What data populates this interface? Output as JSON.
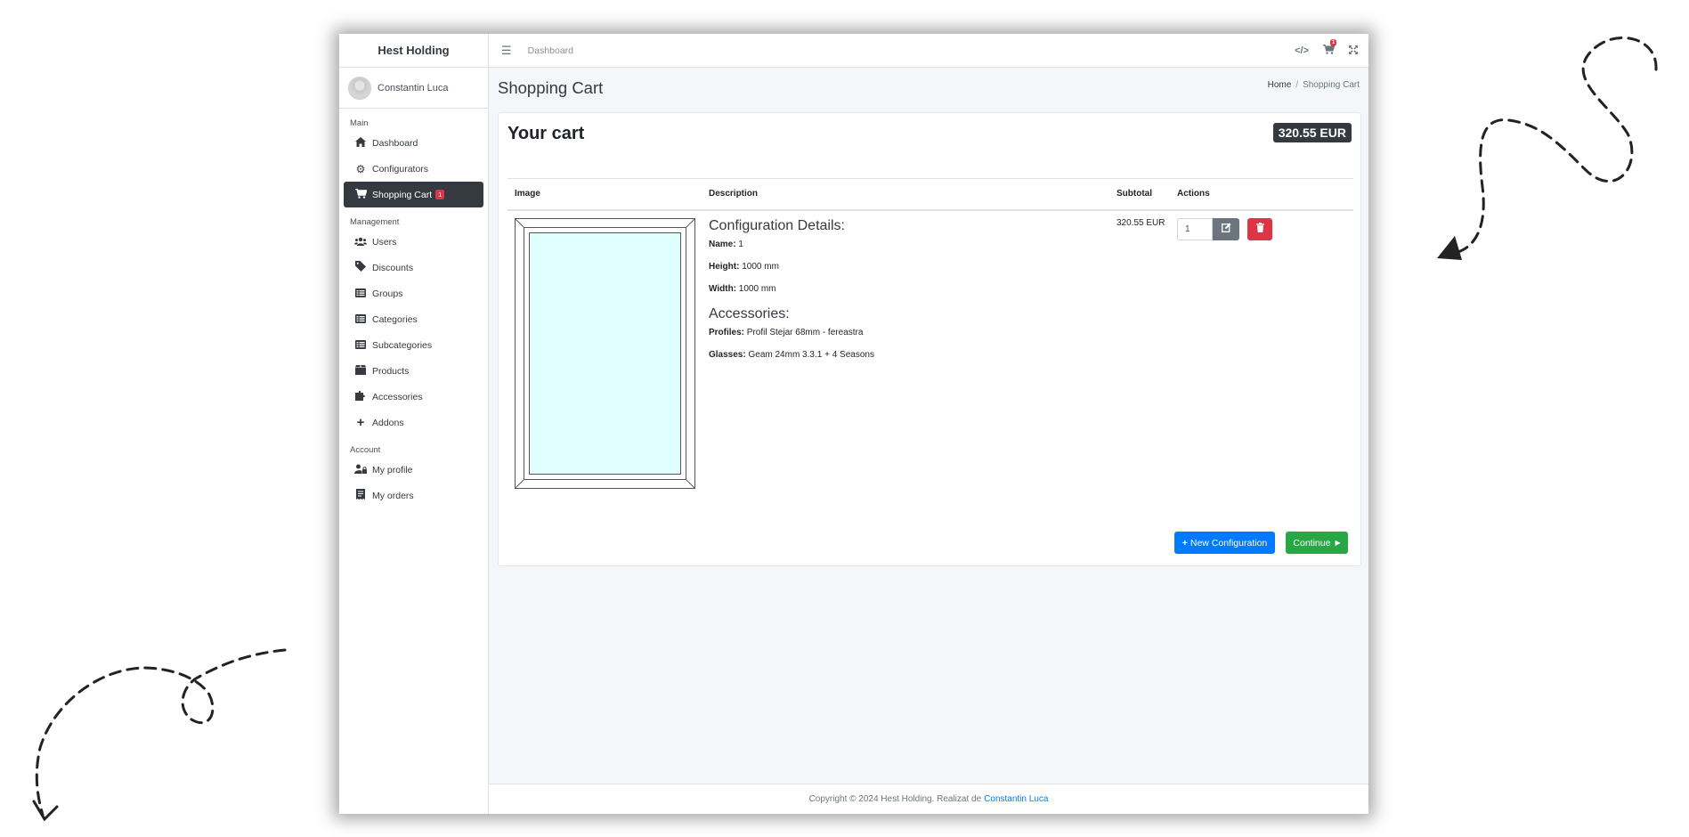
{
  "app": {
    "brand": "Hest Holding"
  },
  "user": {
    "name": "Constantin Luca"
  },
  "topbar": {
    "link": "Dashboard",
    "cart_count": "1"
  },
  "sidebar": {
    "sections": [
      {
        "header": "Main",
        "items": [
          {
            "label": "Dashboard",
            "icon": "home-icon"
          },
          {
            "label": "Configurators",
            "icon": "gear-icon"
          },
          {
            "label": "Shopping Cart",
            "icon": "cart-icon",
            "badge": "1",
            "active": true
          }
        ]
      },
      {
        "header": "Management",
        "items": [
          {
            "label": "Users",
            "icon": "users-icon"
          },
          {
            "label": "Discounts",
            "icon": "tag-icon"
          },
          {
            "label": "Groups",
            "icon": "list-icon"
          },
          {
            "label": "Categories",
            "icon": "list-icon"
          },
          {
            "label": "Subcategories",
            "icon": "list-icon"
          },
          {
            "label": "Products",
            "icon": "box-icon"
          },
          {
            "label": "Accessories",
            "icon": "puzzle-icon"
          },
          {
            "label": "Addons",
            "icon": "plus-icon"
          }
        ]
      },
      {
        "header": "Account",
        "items": [
          {
            "label": "My profile",
            "icon": "user-lock-icon"
          },
          {
            "label": "My orders",
            "icon": "receipt-icon"
          }
        ]
      }
    ]
  },
  "page": {
    "title": "Shopping Cart",
    "breadcrumb": {
      "home": "Home",
      "sep": "/",
      "current": "Shopping Cart"
    }
  },
  "cart": {
    "title": "Your cart",
    "total": "320.55 EUR",
    "columns": {
      "image": "Image",
      "description": "Description",
      "subtotal": "Subtotal",
      "actions": "Actions"
    },
    "item": {
      "details_title": "Configuration Details:",
      "name_label": "Name:",
      "name_value": "1",
      "height_label": "Height:",
      "height_value": "1000 mm",
      "width_label": "Width:",
      "width_value": "1000 mm",
      "accessories_title": "Accessories:",
      "profiles_label": "Profiles:",
      "profiles_value": "Profil Stejar 68mm - fereastra",
      "glasses_label": "Glasses:",
      "glasses_value": "Geam 24mm 3.3.1 + 4 Seasons",
      "subtotal": "320.55 EUR",
      "quantity": "1"
    },
    "new_config_label": "New Configuration",
    "continue_label": "Continue"
  },
  "footer": {
    "text": "Copyright © 2024 Hest Holding. Realizat de",
    "link": "Constantin Luca"
  },
  "colors": {
    "primary": "#007bff",
    "success": "#28a745",
    "danger": "#dc3545",
    "dark": "#343a40",
    "glass": "#e0ffff"
  }
}
